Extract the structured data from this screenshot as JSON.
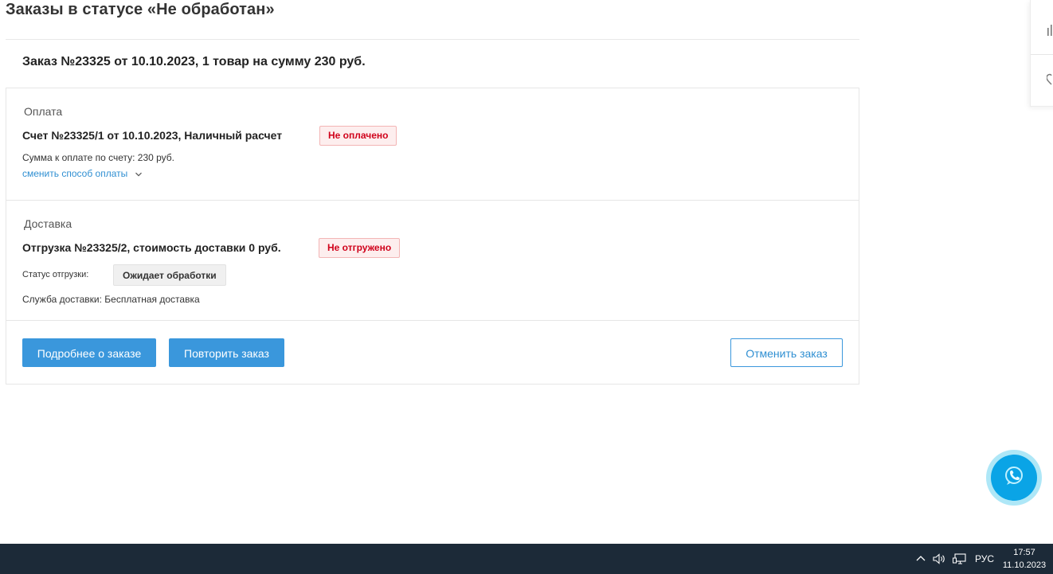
{
  "page": {
    "title": "Заказы в статусе «Не обработан»"
  },
  "order": {
    "heading": "Заказ №23325 от 10.10.2023, 1 товар на сумму 230 руб."
  },
  "payment": {
    "section_label": "Оплата",
    "invoice_title": "Счет №23325/1 от 10.10.2023, Наличный расчет",
    "status_badge": "Не оплачено",
    "amount_text": "Сумма к оплате по счету: 230 руб.",
    "change_link": "сменить способ оплаты"
  },
  "delivery": {
    "section_label": "Доставка",
    "shipment_title": "Отгрузка №23325/2, стоимость доставки 0 руб.",
    "status_badge": "Не отгружено",
    "status_label": "Статус отгрузки:",
    "status_value": "Ожидает обработки",
    "service_text": "Служба доставки: Бесплатная доставка"
  },
  "actions": {
    "details_label": "Подробнее о заказе",
    "repeat_label": "Повторить заказ",
    "cancel_label": "Отменить заказ"
  },
  "taskbar": {
    "language": "РУС",
    "time": "17:57",
    "date": "11.10.2023"
  },
  "colors": {
    "accent_blue": "#3a97dc",
    "link_blue": "#2f8fd2",
    "status_red": "#d0021b",
    "taskbar_bg": "#1c2a38",
    "chat_button": "#0aa4e6"
  },
  "icons": {
    "side_top": "bar-chart-icon",
    "side_bottom": "heart-icon",
    "chat": "chat-phone-icon",
    "dropdown": "chevron-down-icon",
    "tray_up": "chevron-up-icon",
    "tray_volume": "speaker-icon",
    "tray_network": "network-icon"
  }
}
